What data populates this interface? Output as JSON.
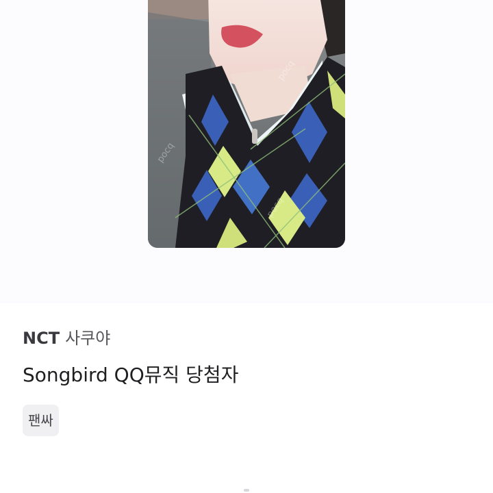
{
  "product": {
    "brand": "NCT",
    "member": "사쿠야",
    "title": "Songbird QQ뮤직 당첨자",
    "tag": "팬싸"
  },
  "colors": {
    "background": "#ffffff",
    "photo_area": "#fcfbfd",
    "tag_background": "#f0f0f2",
    "title_text": "#1f1f22"
  }
}
